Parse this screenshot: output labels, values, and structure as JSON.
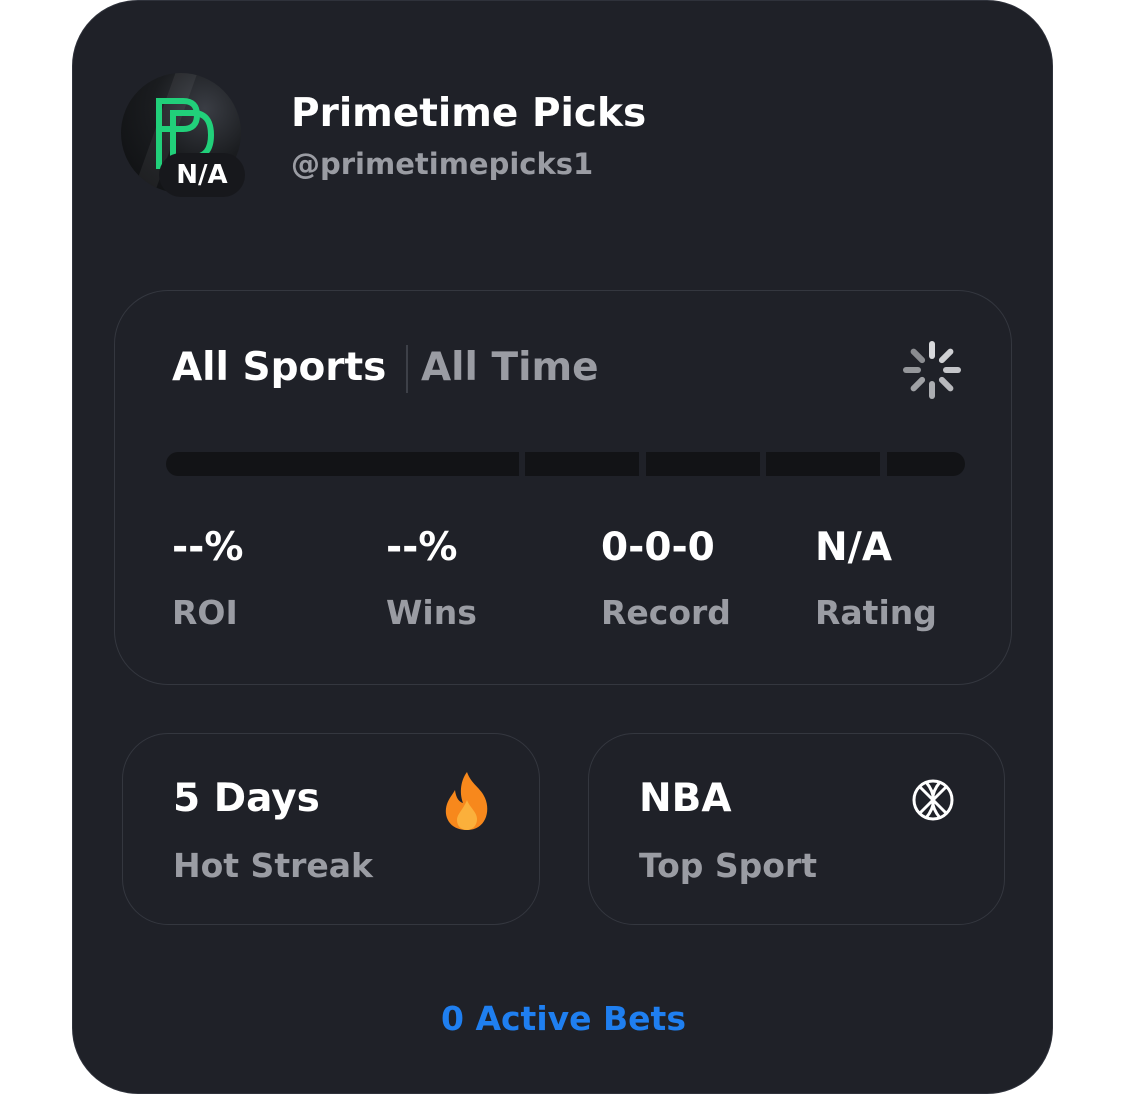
{
  "profile": {
    "name": "Primetime Picks",
    "handle": "@primetimepicks1",
    "badge": "N/A",
    "avatar_icon": "pp-logo-icon",
    "logo_color": "#21d07a"
  },
  "stats": {
    "filter_sport": "All Sports",
    "filter_time": "All Time",
    "spinner_icon": "loading-spinner-icon",
    "items": [
      {
        "value": "--%",
        "label": "ROI"
      },
      {
        "value": "--%",
        "label": "Wins"
      },
      {
        "value": "0-0-0",
        "label": "Record"
      },
      {
        "value": "N/A",
        "label": "Rating"
      }
    ]
  },
  "streak": {
    "value": "5 Days",
    "label": "Hot Streak",
    "icon": "fire-icon",
    "icon_color": "#f7881c"
  },
  "top_sport": {
    "value": "NBA",
    "label": "Top Sport",
    "icon": "basketball-icon"
  },
  "active_bets": {
    "label": "0 Active Bets",
    "color": "#1f7ff0"
  }
}
